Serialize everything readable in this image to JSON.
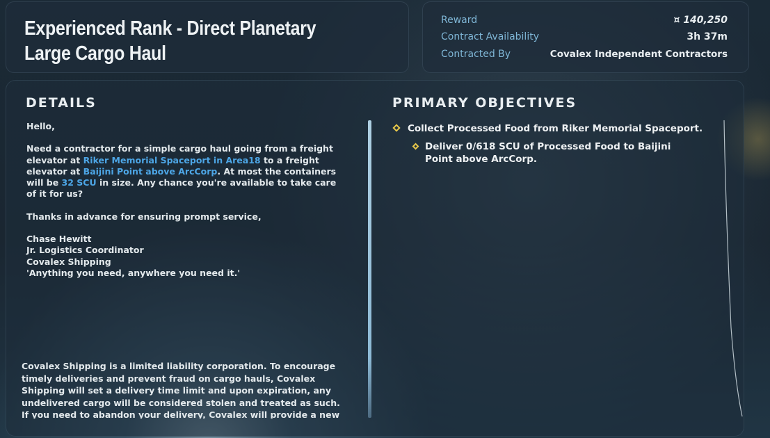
{
  "contract": {
    "title": "Experienced Rank - Direct Planetary Large Cargo Haul"
  },
  "info": {
    "reward_label": "Reward",
    "reward_value": "¤ 140,250",
    "availability_label": "Contract Availability",
    "availability_value": "3h 37m",
    "contracted_by_label": "Contracted By",
    "contracted_by_value": "Covalex Independent Contractors"
  },
  "details": {
    "heading": "DETAILS",
    "greeting": "Hello,",
    "body": {
      "p1": "Need a contractor for a simple cargo haul going from a freight elevator at ",
      "link1": "Riker Memorial Spaceport in Area18",
      "p2": " to a freight elevator at ",
      "link2": "Baijini Point above ArcCorp",
      "p3": ". At most the containers will be ",
      "link3": "32 SCU",
      "p4": " in size. Any chance you're available to take care of it for us?"
    },
    "thanks": "Thanks in advance for ensuring prompt service,",
    "signature": {
      "name": "Chase Hewitt",
      "role": "Jr. Logistics Coordinator",
      "company": "Covalex Shipping",
      "motto": "'Anything you need, anywhere you need it.'"
    },
    "disclaimer": "Covalex Shipping is a limited liability corporation. To encourage timely deliveries and prevent fraud on cargo hauls, Covalex Shipping will set a delivery time limit and upon expiration, any undelivered cargo will be considered stolen and treated as such. If you need to abandon your delivery, Covalex will provide a new drop"
  },
  "objectives": {
    "heading": "PRIMARY OBJECTIVES",
    "items": [
      {
        "text": "Collect Processed Food from Riker Memorial Spaceport."
      },
      {
        "text": "Deliver 0/618 SCU of Processed Food to Baijini Point above ArcCorp."
      }
    ]
  },
  "colors": {
    "accent_link": "#4da6e6",
    "label_blue": "#7fb6d6",
    "objective_diamond": "#e8c84a"
  },
  "icons": {
    "objective_marker": "diamond-icon"
  }
}
